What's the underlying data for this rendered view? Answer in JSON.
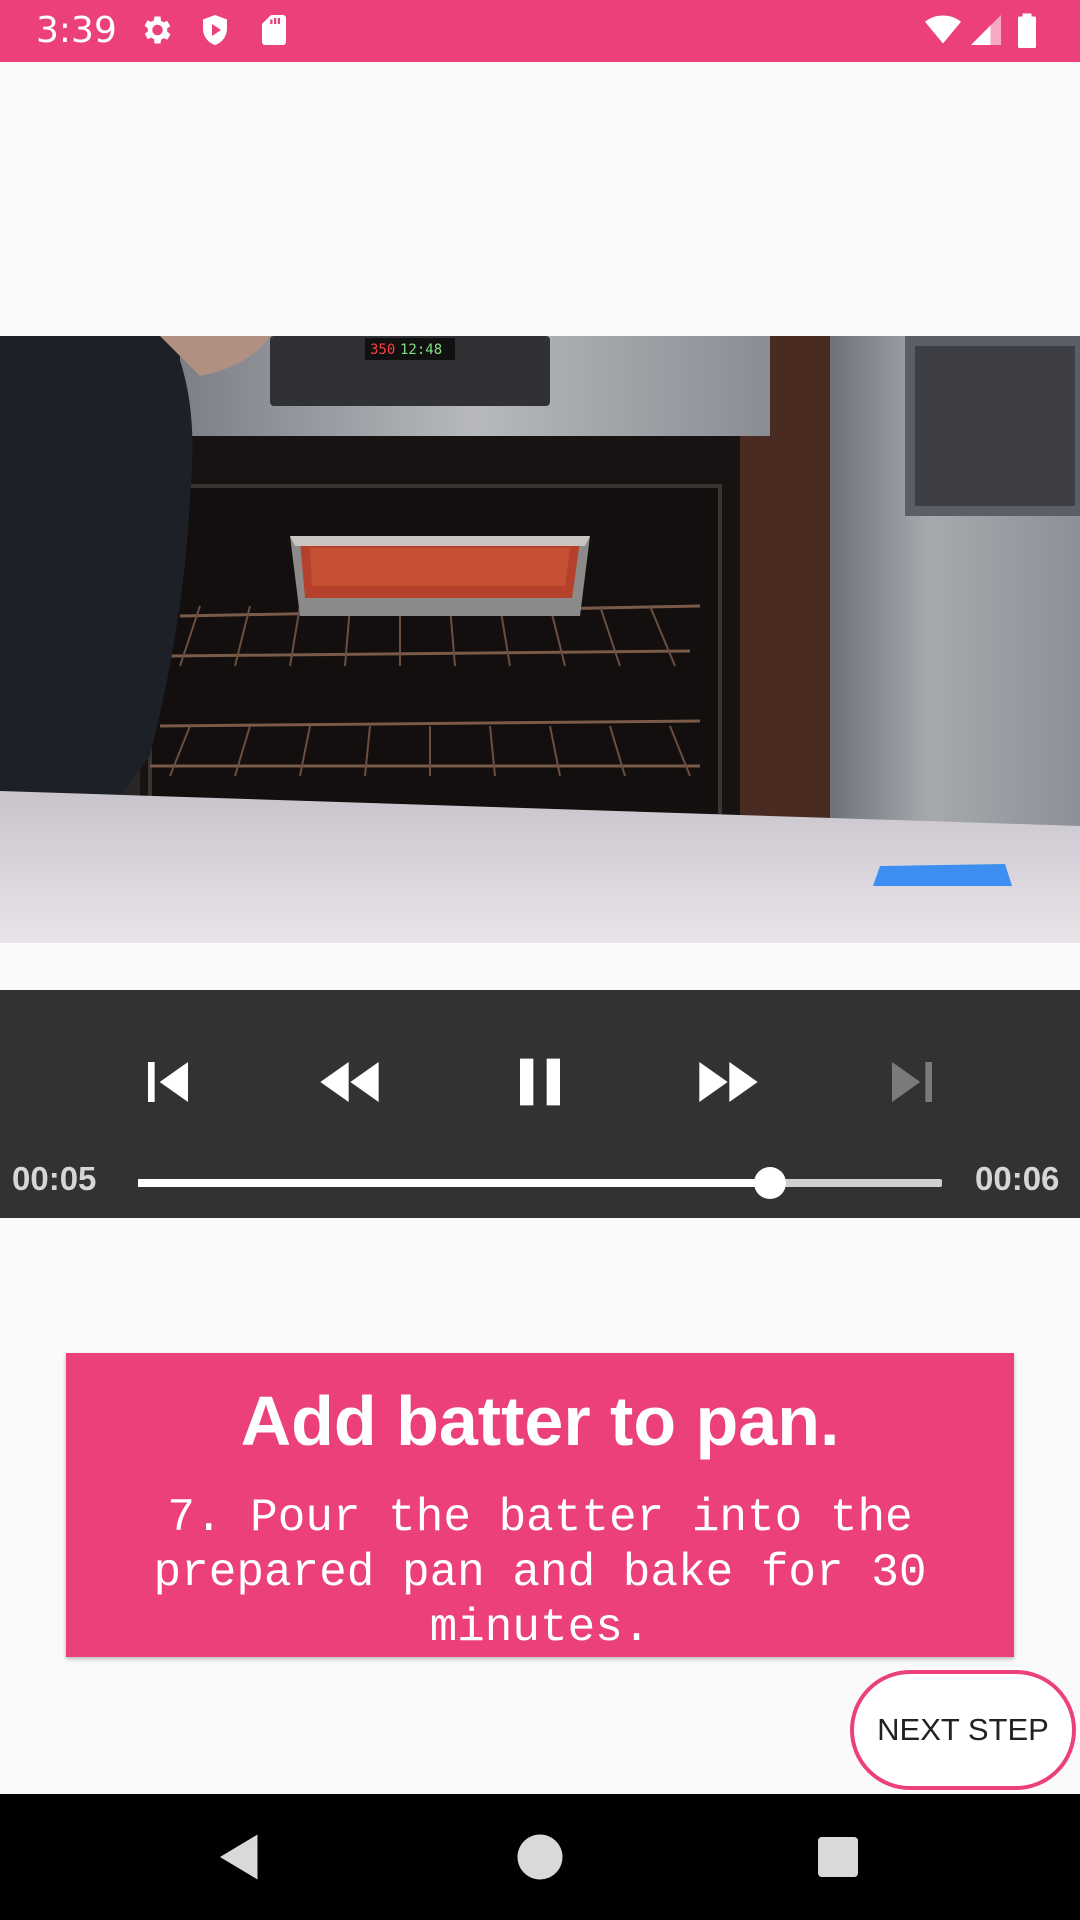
{
  "status_bar": {
    "time": "3:39",
    "background": "#ec407a",
    "icons_left": [
      "gear-icon",
      "shield-icon",
      "sd-card-icon"
    ],
    "icons_right": [
      "wifi-icon",
      "signal-icon",
      "battery-icon"
    ]
  },
  "video": {
    "scene": "oven with baking pan of batter on rack"
  },
  "player": {
    "position": "00:05",
    "duration": "00:06",
    "progress": 0.786,
    "controls": [
      "previous-icon",
      "rewind-icon",
      "pause-icon",
      "fast-forward-icon",
      "next-icon"
    ],
    "next_enabled": false
  },
  "step": {
    "title": "Add batter to pan.",
    "description": "7. Pour the batter into the prepared pan and bake for 30 minutes."
  },
  "next_button": {
    "label": "NEXT STEP"
  },
  "nav_bar": {
    "buttons": [
      "back-icon",
      "home-icon",
      "recents-icon"
    ]
  },
  "colors": {
    "accent": "#ec407a",
    "player_bg": "#323232",
    "page_bg": "#fafafa"
  }
}
